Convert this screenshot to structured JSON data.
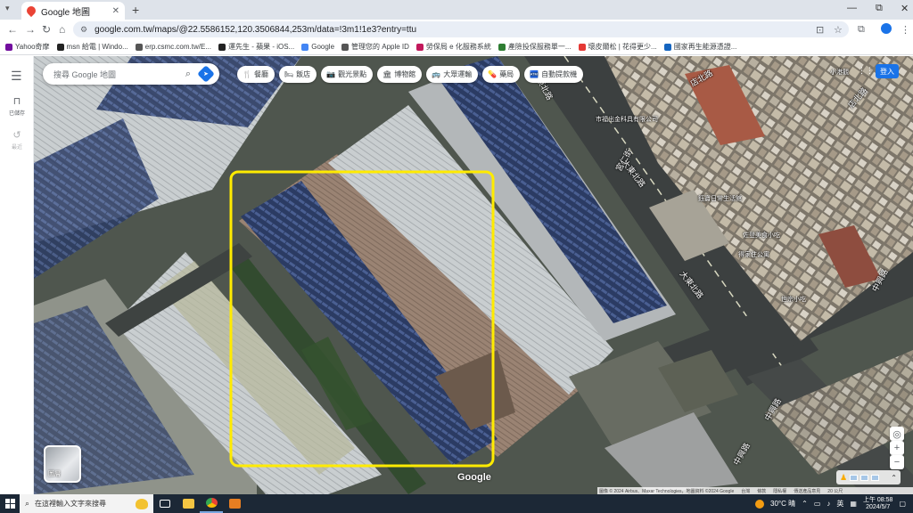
{
  "browser": {
    "tab_title": "Google 地圖",
    "tab_close": "✕",
    "new_tab": "+",
    "url": "google.com.tw/maps/@22.5586152,120.3506844,253m/data=!3m1!1e3?entry=ttu",
    "window_controls": [
      "—",
      "⧉",
      "✕"
    ]
  },
  "bookmarks": [
    {
      "label": "Yahoo奇摩",
      "color": "#720e9e"
    },
    {
      "label": "msn 給電 | Windo...",
      "color": "#222222"
    },
    {
      "label": "erp.csmc.com.tw/E...",
      "color": "#555555"
    },
    {
      "label": "運先生 - 蘋果 - iOS...",
      "color": "#222222"
    },
    {
      "label": "Google",
      "color": "#4285f4"
    },
    {
      "label": "管理您的 Apple ID",
      "color": "#555555"
    },
    {
      "label": "勞保局 e 化服務系統",
      "color": "#c2185b"
    },
    {
      "label": "產險投保服務單一...",
      "color": "#2e7d32"
    },
    {
      "label": "壞皮爾松 | 花得更少...",
      "color": "#e53935"
    },
    {
      "label": "國家再生能源憑證...",
      "color": "#1565c0"
    }
  ],
  "sidebar": {
    "menu_icon": "☰",
    "saved_label": "已儲存",
    "recent_label": "最近"
  },
  "search": {
    "placeholder": "搜尋 Google 地圖"
  },
  "chips": [
    {
      "icon": "🍴",
      "label": "餐廳"
    },
    {
      "icon": "🛏",
      "label": "飯店"
    },
    {
      "icon": "📷",
      "label": "觀光景點"
    },
    {
      "icon": "🏛",
      "label": "博物館"
    },
    {
      "icon": "🚌",
      "label": "大眾運輸"
    },
    {
      "icon": "💊",
      "label": "藥局"
    },
    {
      "icon": "🏧",
      "label": "自動提款機"
    }
  ],
  "header_right": {
    "login": "登入",
    "apps_icon": "grid-icon"
  },
  "map_labels": {
    "road_dadong": "大東北路",
    "road_dadong2": "大東北路",
    "road_dongbei": "東北路",
    "road_zhongshan": "中興路",
    "road_zhongshan2": "中興路",
    "road_zhongshan3": "中興路",
    "road_jiren": "宮仁街",
    "road_dianbei": "店北路",
    "road_dianbei2": "店北路",
    "road_xiaogang": "小港觀",
    "shop1": "市福出金科具有限公司",
    "shop2": "鈺寶日常生活館",
    "shop3": "得家住公寓",
    "shop4": "佐登美食小吃",
    "shop5": "世宗小吃",
    "layers_label": "圖層"
  },
  "map_footer": {
    "google": "Google",
    "attribution": "圖像 © 2024 Airbus、Maxar Technologies，地圖資料 ©2024 Google",
    "links": [
      "台灣",
      "條款",
      "隱私權",
      "傳送產品意見",
      "20 公尺"
    ]
  },
  "taskbar": {
    "search_placeholder": "在這裡輸入文字來搜尋",
    "weather": "30°C 晴",
    "ime": "英",
    "time": "上午 08:58",
    "date": "2024/5/7"
  },
  "colors": {
    "highlight_box": "#ffeb00",
    "accent": "#1a73e8"
  }
}
